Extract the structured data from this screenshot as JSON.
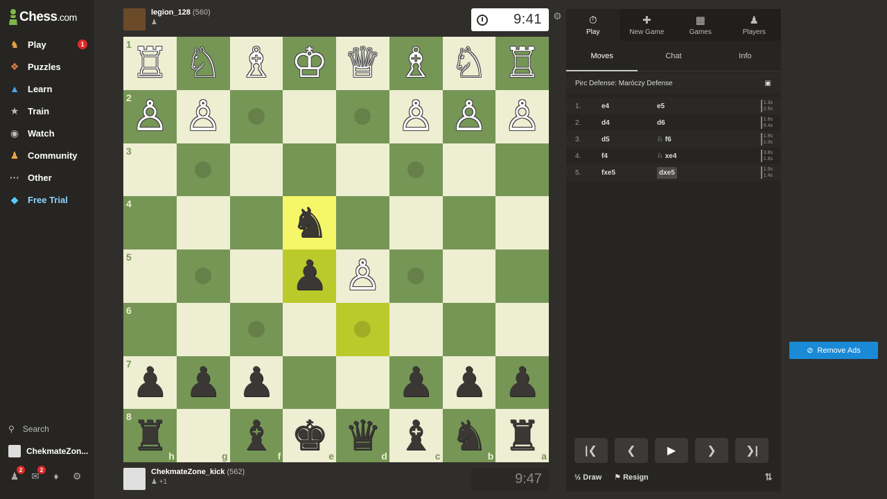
{
  "sidebar": {
    "logo_main": "Chess",
    "logo_suffix": ".com",
    "items": [
      {
        "label": "Play",
        "icon": "play-icon",
        "badge": "1"
      },
      {
        "label": "Puzzles",
        "icon": "puzzle-icon"
      },
      {
        "label": "Learn",
        "icon": "graduation-cap-icon"
      },
      {
        "label": "Train",
        "icon": "train-icon"
      },
      {
        "label": "Watch",
        "icon": "binoculars-icon"
      },
      {
        "label": "Community",
        "icon": "community-icon"
      },
      {
        "label": "Other",
        "icon": "more-icon"
      },
      {
        "label": "Free Trial",
        "icon": "diamond-icon"
      }
    ],
    "search_label": "Search",
    "user_label": "ChekmateZon...",
    "friends_badge": "2",
    "messages_badge": "2"
  },
  "top_player": {
    "name": "legion_128",
    "rating": "(560)",
    "clock": "9:41"
  },
  "bottom_player": {
    "name": "ChekmateZone_kick",
    "rating": "(562)",
    "sub": "+1",
    "clock": "9:47"
  },
  "board": {
    "ranks": [
      "1",
      "2",
      "3",
      "4",
      "5",
      "6",
      "7",
      "8"
    ],
    "files": [
      "h",
      "g",
      "f",
      "e",
      "d",
      "c",
      "b",
      "a"
    ],
    "rows": [
      [
        "wR",
        "wN",
        "wB",
        "wK",
        "wQ",
        "wB",
        "wN",
        "wR"
      ],
      [
        "wP",
        "wP",
        "",
        "",
        "",
        "wP",
        "wP",
        "wP"
      ],
      [
        "",
        "",
        "",
        "",
        "",
        "",
        "",
        ""
      ],
      [
        "",
        "",
        "",
        "bN",
        "",
        "",
        "",
        ""
      ],
      [
        "",
        "",
        "",
        "bP",
        "wP",
        "",
        "",
        ""
      ],
      [
        "",
        "",
        "",
        "",
        "",
        "",
        "",
        ""
      ],
      [
        "bP",
        "bP",
        "bP",
        "",
        "",
        "bP",
        "bP",
        "bP"
      ],
      [
        "bR",
        "",
        "bB",
        "bK",
        "bQ",
        "bB",
        "bN",
        "bR"
      ]
    ],
    "highlight": [
      [
        3,
        3
      ],
      [
        4,
        3
      ],
      [
        5,
        4
      ]
    ],
    "dots": [
      [
        1,
        2
      ],
      [
        1,
        4
      ],
      [
        2,
        1
      ],
      [
        2,
        5
      ],
      [
        4,
        1
      ],
      [
        4,
        5
      ],
      [
        5,
        2
      ],
      [
        5,
        4
      ]
    ]
  },
  "panel": {
    "tabs": [
      {
        "label": "Play",
        "icon": "stopwatch-icon"
      },
      {
        "label": "New Game",
        "icon": "plus-icon"
      },
      {
        "label": "Games",
        "icon": "board-icon"
      },
      {
        "label": "Players",
        "icon": "players-icon"
      }
    ],
    "subtabs": [
      "Moves",
      "Chat",
      "Info"
    ],
    "opening": "Pirc Defense: Maróczy Defense",
    "moves": [
      {
        "n": "1.",
        "w": "e4",
        "b": "e5",
        "tw": "1.3s",
        "tb": "2.5s"
      },
      {
        "n": "2.",
        "w": "d4",
        "b": "d6",
        "tw": "1.8s",
        "tb": "6.4s"
      },
      {
        "n": "3.",
        "w": "d5",
        "b": "♘ f6",
        "tw": "1.9s",
        "tb": "1.0s"
      },
      {
        "n": "4.",
        "w": "f4",
        "b": "♘ xe4",
        "tw": "3.8s",
        "tb": "1.6s"
      },
      {
        "n": "5.",
        "w": "fxe5",
        "b": "dxe5",
        "tw": "1.5s",
        "tb": "1.4s"
      }
    ],
    "draw_label": "Draw",
    "resign_label": "Resign"
  },
  "ad": {
    "remove_label": "Remove Ads"
  }
}
